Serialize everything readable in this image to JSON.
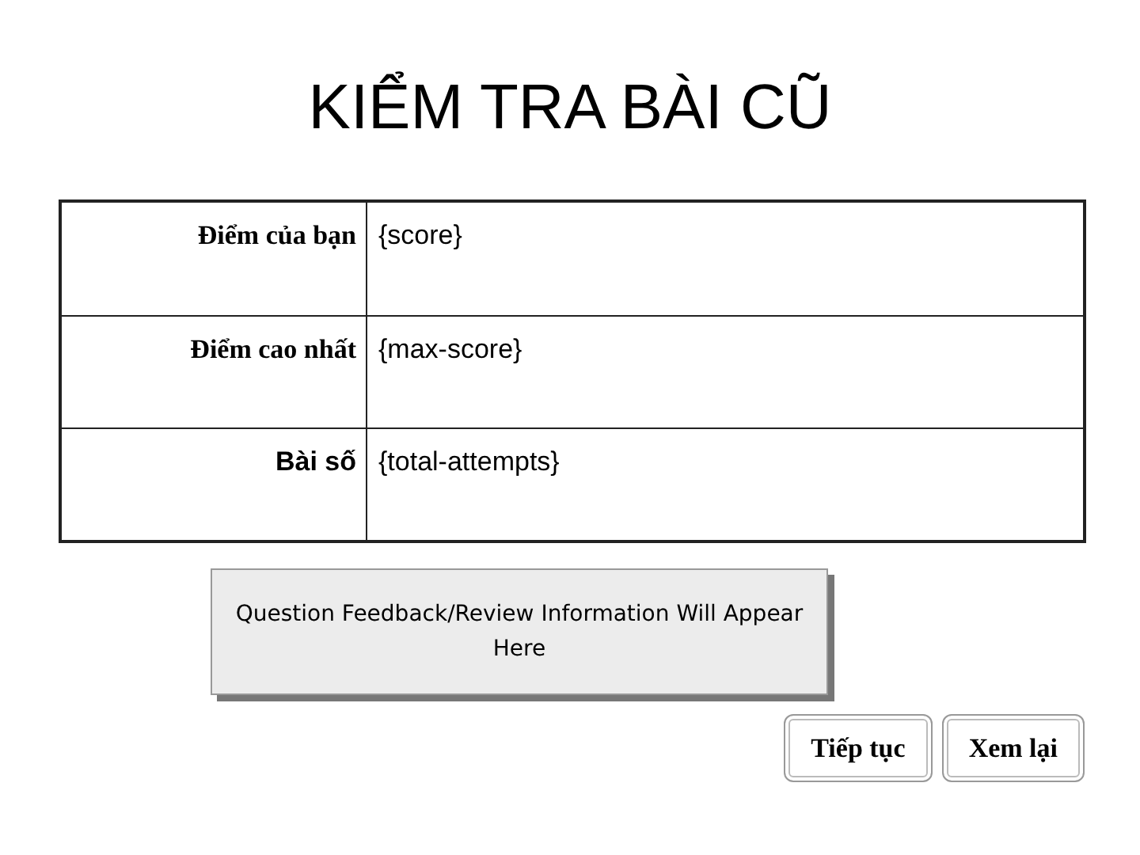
{
  "title": "KIỂM TRA BÀI CŨ",
  "results": [
    {
      "kind": "serif",
      "label": "Điểm của bạn",
      "value": "{score}"
    },
    {
      "kind": "serif",
      "label": "Điểm cao nhất",
      "value": "{max-score}"
    },
    {
      "kind": "sans",
      "label": "Bài số",
      "value": "{total-attempts}"
    }
  ],
  "feedback": "Question Feedback/Review Information Will Appear Here",
  "buttons": [
    "Tiếp tục",
    "Xem lại"
  ]
}
